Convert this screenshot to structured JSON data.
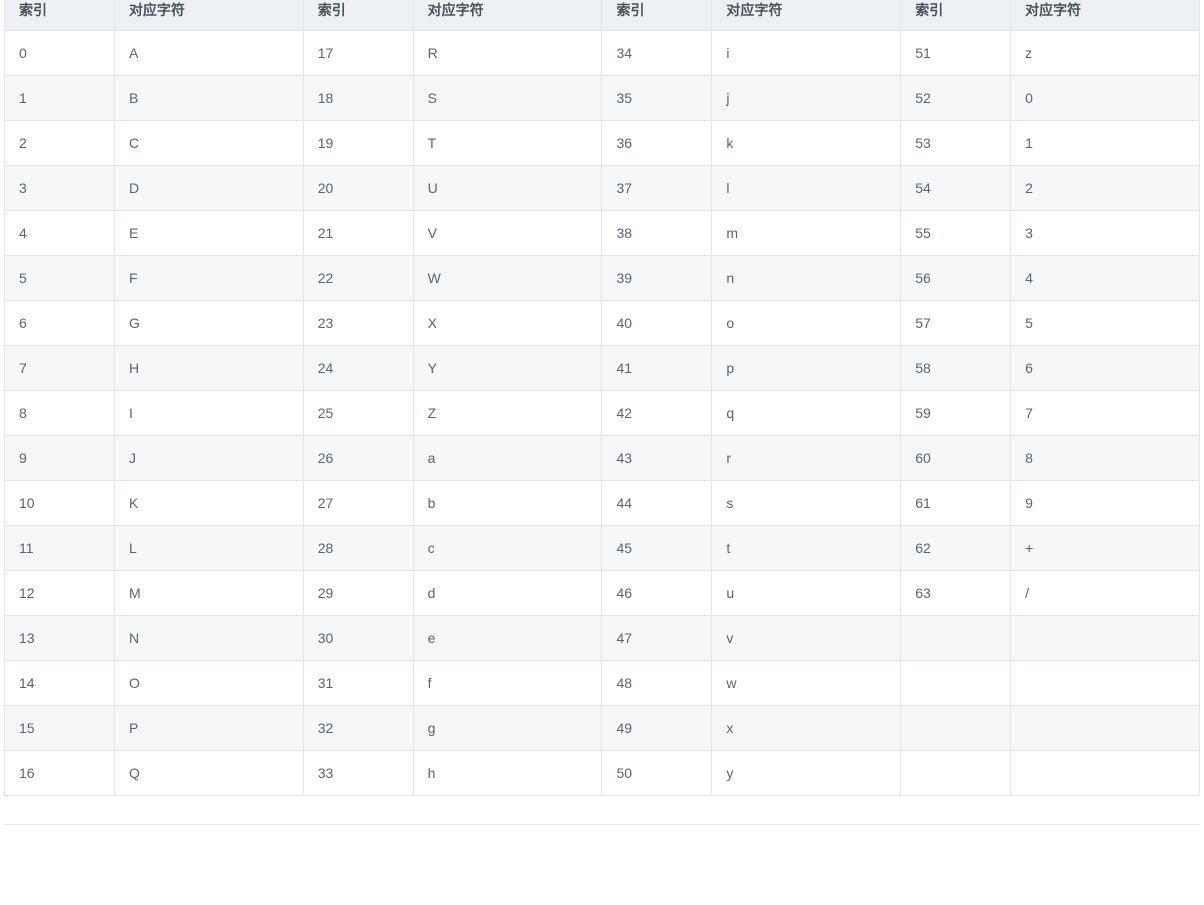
{
  "headers": {
    "index": "索引",
    "char": "对应字符"
  },
  "rows": [
    {
      "c": [
        "0",
        "A",
        "17",
        "R",
        "34",
        "i",
        "51",
        "z"
      ]
    },
    {
      "c": [
        "1",
        "B",
        "18",
        "S",
        "35",
        "j",
        "52",
        "0"
      ]
    },
    {
      "c": [
        "2",
        "C",
        "19",
        "T",
        "36",
        "k",
        "53",
        "1"
      ]
    },
    {
      "c": [
        "3",
        "D",
        "20",
        "U",
        "37",
        "l",
        "54",
        "2"
      ]
    },
    {
      "c": [
        "4",
        "E",
        "21",
        "V",
        "38",
        "m",
        "55",
        "3"
      ]
    },
    {
      "c": [
        "5",
        "F",
        "22",
        "W",
        "39",
        "n",
        "56",
        "4"
      ]
    },
    {
      "c": [
        "6",
        "G",
        "23",
        "X",
        "40",
        "o",
        "57",
        "5"
      ]
    },
    {
      "c": [
        "7",
        "H",
        "24",
        "Y",
        "41",
        "p",
        "58",
        "6"
      ]
    },
    {
      "c": [
        "8",
        "I",
        "25",
        "Z",
        "42",
        "q",
        "59",
        "7"
      ]
    },
    {
      "c": [
        "9",
        "J",
        "26",
        "a",
        "43",
        "r",
        "60",
        "8"
      ]
    },
    {
      "c": [
        "10",
        "K",
        "27",
        "b",
        "44",
        "s",
        "61",
        "9"
      ]
    },
    {
      "c": [
        "11",
        "L",
        "28",
        "c",
        "45",
        "t",
        "62",
        "+"
      ]
    },
    {
      "c": [
        "12",
        "M",
        "29",
        "d",
        "46",
        "u",
        "63",
        "/"
      ]
    },
    {
      "c": [
        "13",
        "N",
        "30",
        "e",
        "47",
        "v",
        "",
        ""
      ]
    },
    {
      "c": [
        "14",
        "O",
        "31",
        "f",
        "48",
        "w",
        "",
        ""
      ]
    },
    {
      "c": [
        "15",
        "P",
        "32",
        "g",
        "49",
        "x",
        "",
        ""
      ]
    },
    {
      "c": [
        "16",
        "Q",
        "33",
        "h",
        "50",
        "y",
        "",
        ""
      ]
    }
  ]
}
